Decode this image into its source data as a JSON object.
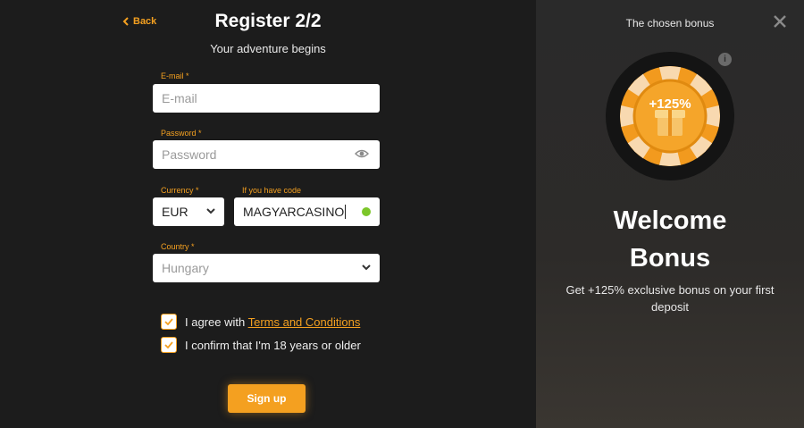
{
  "header": {
    "back_label": "Back",
    "title": "Register 2/2",
    "subtitle": "Your adventure begins"
  },
  "form": {
    "email": {
      "label": "E-mail *",
      "placeholder": "E-mail",
      "value": ""
    },
    "password": {
      "label": "Password *",
      "placeholder": "Password",
      "value": ""
    },
    "currency": {
      "label": "Currency *",
      "value": "EUR"
    },
    "code": {
      "label": "If you have code",
      "value": "MAGYARCASINO"
    },
    "country": {
      "label": "Country *",
      "value": "Hungary"
    }
  },
  "agreements": {
    "terms_prefix": "I agree with",
    "terms_link": "Terms and Conditions",
    "terms_checked": true,
    "age_text": "I confirm that I'm 18 years or older",
    "age_checked": true
  },
  "signup_label": "Sign up",
  "bonus_panel": {
    "title": "The chosen bonus",
    "chip_text": "+125%",
    "info_icon": "i",
    "heading_line1": "Welcome",
    "heading_line2": "Bonus",
    "description": "Get +125% exclusive bonus on your first deposit"
  },
  "colors": {
    "accent": "#f4a020",
    "background": "#1c1c1c",
    "success": "#7cc62a"
  }
}
